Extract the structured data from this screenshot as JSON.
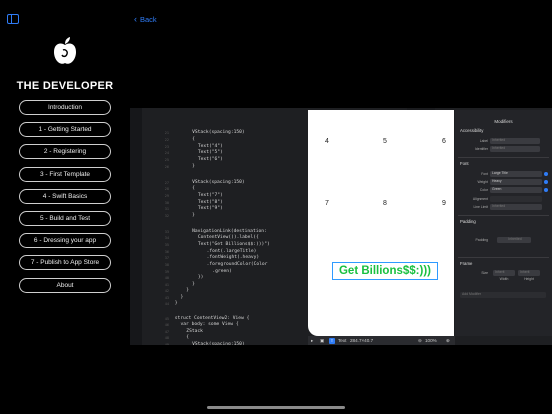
{
  "app": {
    "brand_title": "THE DEVELOPER",
    "back_label": "Back",
    "accent_color": "#2f7cf6"
  },
  "menu": [
    {
      "label": "Introduction"
    },
    {
      "label": "1 - Getting Started"
    },
    {
      "label": "2 - Registering"
    },
    {
      "label": "3 - First Template"
    },
    {
      "label": "4 - Swift Basics"
    },
    {
      "label": "5 - Build and Test"
    },
    {
      "label": "6 - Dressing your app"
    },
    {
      "label": "7 - Publish to App Store"
    },
    {
      "label": "About"
    }
  ],
  "code_lines": [
    {
      "n": "21",
      "t": "VStack(spacing:150)"
    },
    {
      "n": "22",
      "t": "{"
    },
    {
      "n": "23",
      "t": "Text(\"4\")"
    },
    {
      "n": "24",
      "t": "Text(\"5\")"
    },
    {
      "n": "25",
      "t": "Text(\"6\")"
    },
    {
      "n": "26",
      "t": "}"
    },
    {
      "n": "27",
      "t": "VStack(spacing:150)"
    },
    {
      "n": "28",
      "t": "{"
    },
    {
      "n": "29",
      "t": "Text(\"7\")"
    },
    {
      "n": "30",
      "t": "Text(\"8\")"
    },
    {
      "n": "31",
      "t": "Text(\"9\")"
    },
    {
      "n": "32",
      "t": "}"
    },
    {
      "n": "33",
      "t": "NavigationLink(destination:"
    },
    {
      "n": "34",
      "t": "ContentView()).label({"
    },
    {
      "n": "35",
      "t": "Text(\"Get Billions$$:)))\")"
    },
    {
      "n": "36",
      "t": ".font(.largeTitle)"
    },
    {
      "n": "37",
      "t": ".fontWeight(.heavy)"
    },
    {
      "n": "38",
      "t": ".foregroundColor(Color"
    },
    {
      "n": "39",
      "t": ".green)"
    },
    {
      "n": "40",
      "t": "})"
    },
    {
      "n": "41",
      "t": "}"
    },
    {
      "n": "42",
      "t": "}"
    },
    {
      "n": "43",
      "t": "}"
    },
    {
      "n": "44",
      "t": "}"
    },
    {
      "n": "45",
      "t": "struct ContentView2: View {"
    },
    {
      "n": "46",
      "t": "var body: some View {"
    },
    {
      "n": "47",
      "t": "ZStack"
    },
    {
      "n": "48",
      "t": "{"
    },
    {
      "n": "49",
      "t": "VStack(spacing:150)"
    }
  ],
  "preview": {
    "grid": [
      "4",
      "5",
      "6",
      "7",
      "8",
      "9"
    ],
    "button_text": "Get Billions$$:)))"
  },
  "inspector": {
    "title": "Modifiers",
    "accessibility": "Accessibility",
    "label_label": "Label",
    "label_placeholder": "Inherited",
    "identifier_label": "Identifier",
    "identifier_placeholder": "Inherited",
    "font_section": "Font",
    "font_label": "Font",
    "font_value": "Large Title",
    "weight_label": "Weight",
    "weight_value": "Heavy",
    "color_label": "Color",
    "color_value": "Green",
    "alignment_label": "Alignment",
    "line_limit_label": "Line Limit",
    "line_limit_value": "Inherited",
    "padding_section": "Padding",
    "padding_label": "Padding",
    "padding_value": "Inherited",
    "frame_section": "Frame",
    "size_label": "Size",
    "width_value": "Inherit",
    "height_value": "Inherit",
    "width_caption": "Width",
    "height_caption": "Height",
    "add_modifier": "Add Modifier"
  },
  "bottombar": {
    "element_type": "Text",
    "dimensions": "284.7×40.7",
    "zoom": "100%"
  }
}
